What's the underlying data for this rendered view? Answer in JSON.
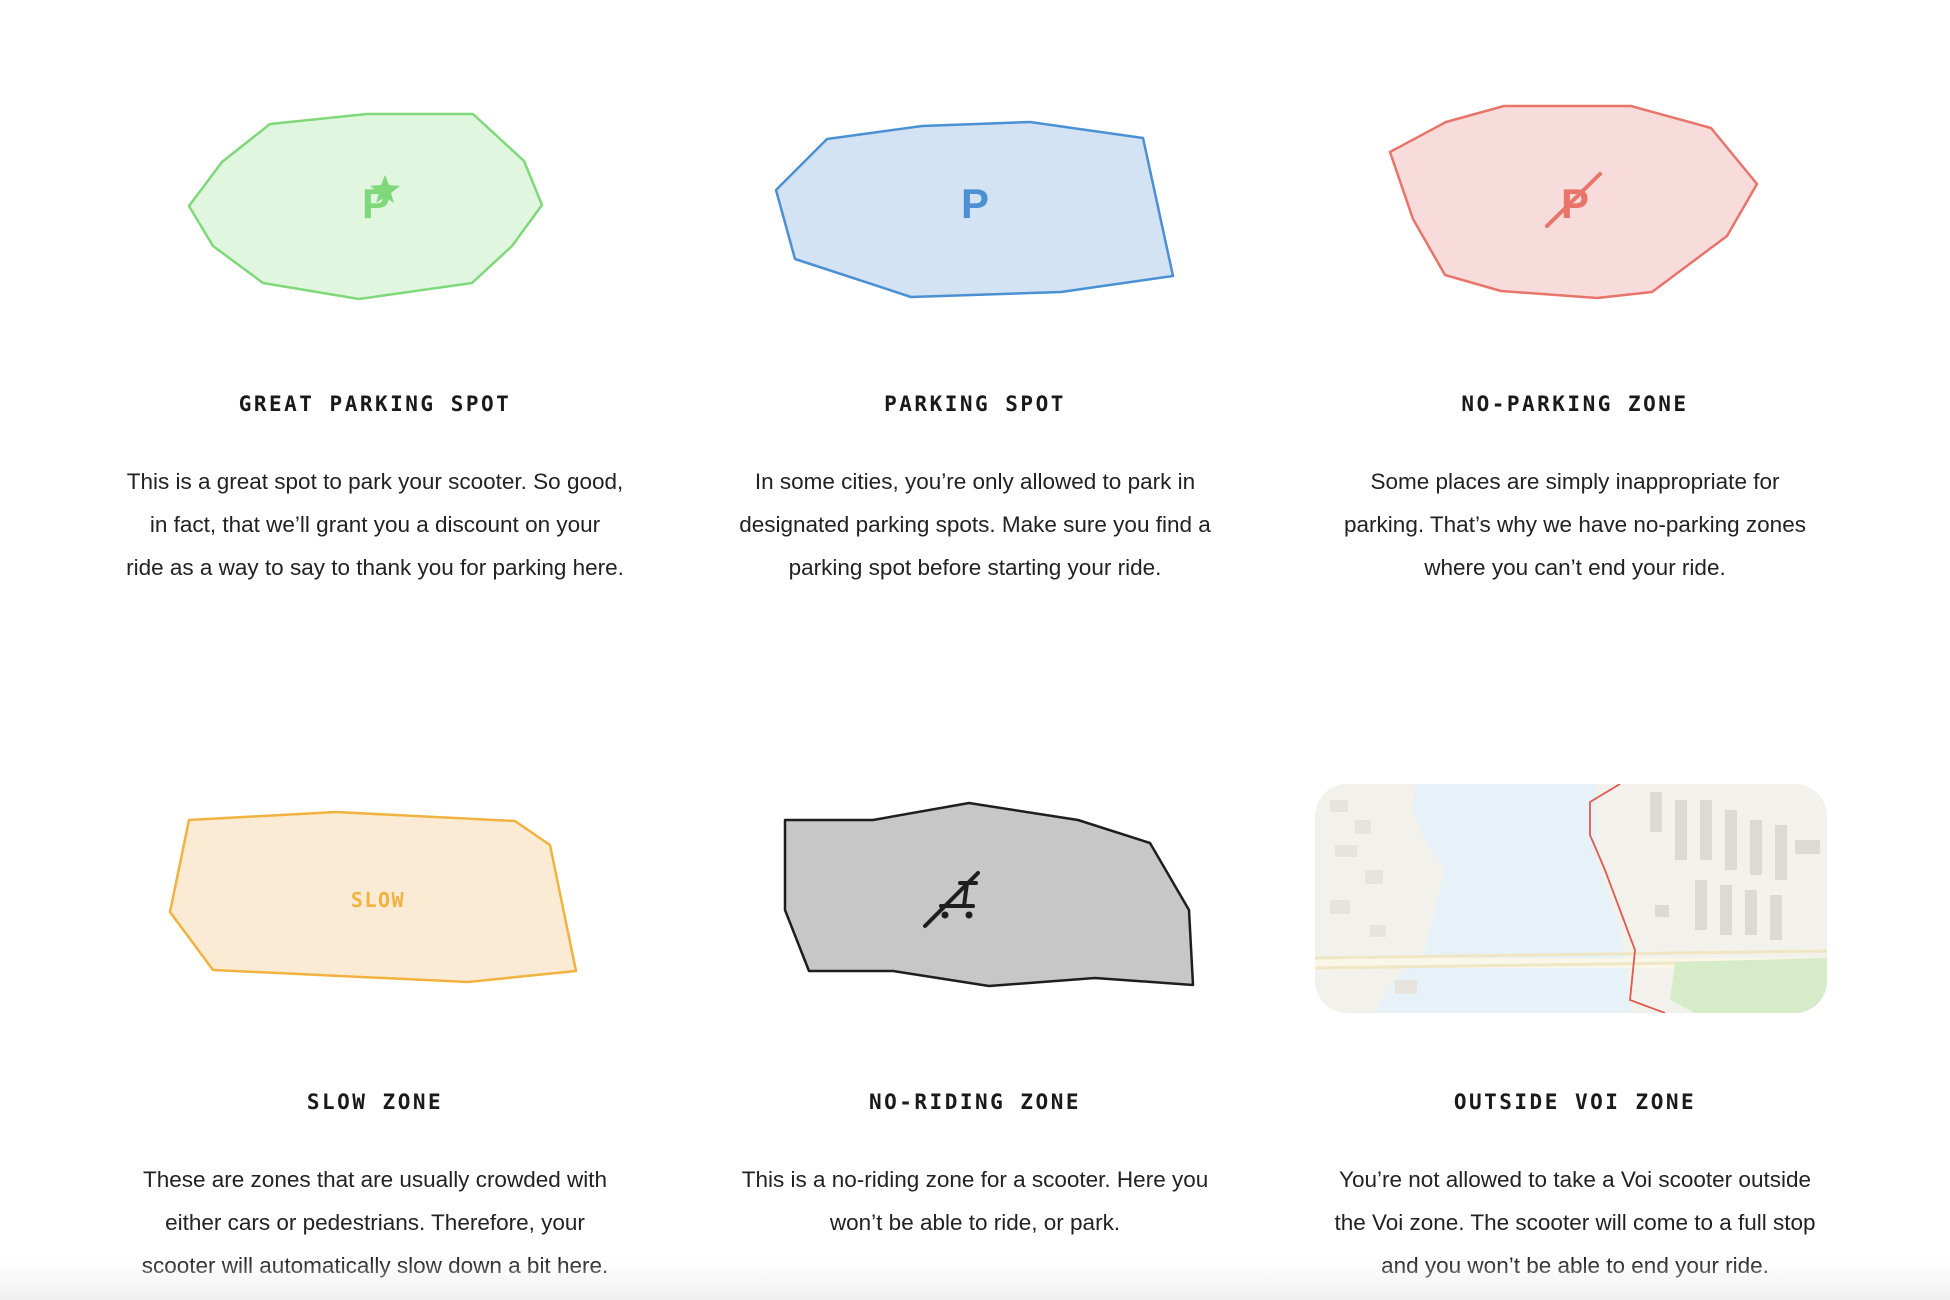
{
  "zones": [
    {
      "id": "great-parking",
      "title": "GREAT PARKING SPOT",
      "lines": [
        "This is a great spot to park your scooter. So good,",
        "in fact, that we’ll grant you a discount on your",
        "ride as a way to say to thank you for parking here."
      ],
      "icon": "parking-star-icon",
      "stroke": "#7fd87a",
      "fill": "#e1f6df"
    },
    {
      "id": "parking",
      "title": "PARKING SPOT",
      "lines": [
        "In some cities, you’re only allowed to park in",
        "designated parking spots. Make sure you find a",
        "parking spot before starting your ride."
      ],
      "icon_text": "P",
      "stroke": "#4a90d2",
      "fill": "#d3e3f4"
    },
    {
      "id": "no-parking",
      "title": "NO-PARKING ZONE",
      "lines": [
        "Some places are simply inappropriate for",
        "parking. That’s why we have no-parking zones",
        "where you can’t end your ride."
      ],
      "icon": "no-parking-icon",
      "stroke": "#e8746a",
      "fill": "#f7dcdb"
    },
    {
      "id": "slow",
      "title": "SLOW ZONE",
      "lines": [
        "These are zones that are usually crowded with",
        "either cars or pedestrians. Therefore, your",
        "scooter will automatically slow down a bit here."
      ],
      "icon_text": "SLOW",
      "stroke": "#f1b240",
      "fill": "#fbebd4"
    },
    {
      "id": "no-riding",
      "title": "NO-RIDING ZONE",
      "lines": [
        "This is a no-riding zone for a scooter. Here you",
        "won’t be able to ride, or park."
      ],
      "icon": "no-scooter-icon",
      "stroke": "#1e1e1e",
      "fill": "#c7c7c7"
    },
    {
      "id": "outside-voi",
      "title": "OUTSIDE VOI ZONE",
      "lines": [
        "You’re not allowed to take a Voi scooter outside",
        "the Voi zone. The scooter will come to a full stop",
        "and you won’t be able to end your ride."
      ],
      "icon": "map-thumbnail",
      "stroke": "#e05a4f",
      "fill": "#f3f1ec"
    }
  ]
}
